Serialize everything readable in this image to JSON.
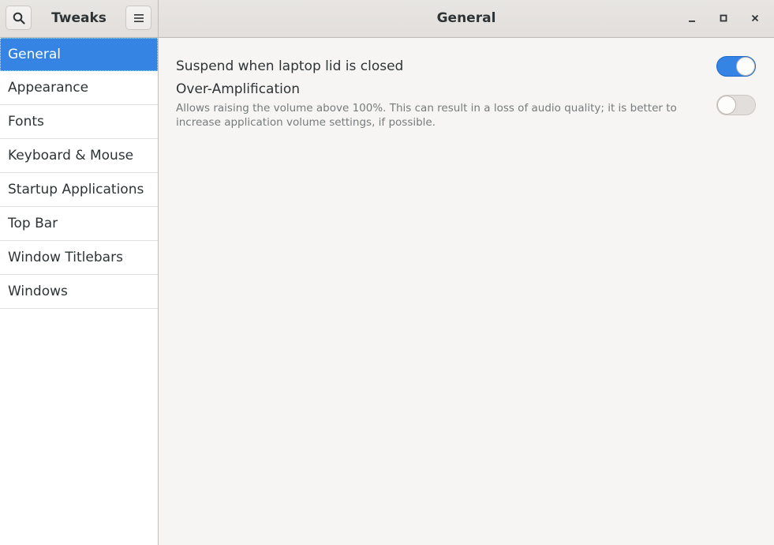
{
  "header": {
    "app_title": "Tweaks",
    "page_title": "General"
  },
  "sidebar": {
    "items": [
      {
        "label": "General",
        "selected": true
      },
      {
        "label": "Appearance",
        "selected": false
      },
      {
        "label": "Fonts",
        "selected": false
      },
      {
        "label": "Keyboard & Mouse",
        "selected": false
      },
      {
        "label": "Startup Applications",
        "selected": false
      },
      {
        "label": "Top Bar",
        "selected": false
      },
      {
        "label": "Window Titlebars",
        "selected": false
      },
      {
        "label": "Windows",
        "selected": false
      }
    ]
  },
  "settings": {
    "suspend_lid": {
      "title": "Suspend when laptop lid is closed",
      "enabled": true
    },
    "over_amplification": {
      "title": "Over-Amplification",
      "description": "Allows raising the volume above 100%. This can result in a loss of audio quality; it is better to increase application volume settings, if possible.",
      "enabled": false
    }
  },
  "icons": {
    "search": "search-icon",
    "menu": "hamburger-menu-icon",
    "minimize": "minimize-icon",
    "maximize": "maximize-icon",
    "close": "close-icon"
  },
  "colors": {
    "accent": "#3584e4",
    "sidebar_bg": "#ffffff",
    "content_bg": "#f6f5f4"
  }
}
